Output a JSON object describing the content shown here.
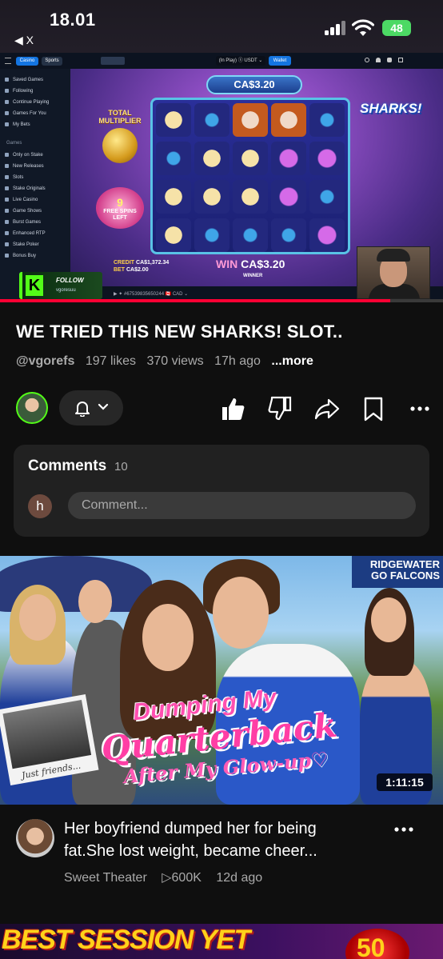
{
  "status_bar": {
    "time": "18.01",
    "back_label": "◀ X",
    "battery": "48"
  },
  "video": {
    "site": {
      "tab_casino": "Casino",
      "tab_sports": "Sports",
      "balance": "(In Play) ⓢ USDT ⌄",
      "wallet": "Wallet",
      "sidebar_items": [
        "Saved Games",
        "Following",
        "Continue Playing",
        "Games For You",
        "My Bets"
      ],
      "sidebar_section": "Games",
      "sidebar_games": [
        "Only on Stake",
        "New Releases",
        "Slots",
        "Stake Originals",
        "Live Casino",
        "Game Shows",
        "Burst Games",
        "Enhanced RTP",
        "Stake Poker",
        "Bonus Buy"
      ],
      "bottom_info": "▶ ✦ #67539835650244    🇨🇦 CAD ⌄"
    },
    "game": {
      "bet_display": "CA$3.20",
      "total_multiplier": "TOTAL MULTIPLIER",
      "free_spins_count": "9",
      "free_spins_label": "FREE SPINS LEFT",
      "logo": "SHARKS!",
      "credit_label": "CREDIT",
      "credit_value": "CA$1,372.34",
      "bet_label": "BET",
      "bet_value": "CA$2.00",
      "win_label": "WIN",
      "win_value": "CA$3.20",
      "winner": "WINNER"
    },
    "follow": {
      "label": "FOLLOW",
      "user": "vgoresuu",
      "k": "K"
    },
    "progress": 0.88
  },
  "video_info": {
    "title": "WE TRIED THIS NEW SHARKS! SLOT..",
    "channel": "@vgorefs",
    "likes": "197 likes",
    "views": "370 views",
    "age": "17h ago",
    "more": "...more"
  },
  "comments": {
    "title": "Comments",
    "count": "10",
    "avatar_letter": "h",
    "placeholder": "Comment..."
  },
  "next_video": {
    "thumb_sign": "RIDGEWATER GO FALCONS",
    "thumb_line1": "Dumping My",
    "thumb_line2": "Quarterback",
    "thumb_line3": "After My Glow-up♡",
    "polaroid_caption": "Just friends...",
    "duration": "1:11:15",
    "title_line1": "Her boyfriend dumped her for being",
    "title_line2": "fat.She lost weight, became cheer...",
    "channel": "Sweet Theater",
    "views": "▷600K",
    "age": "12d ago"
  },
  "banner": {
    "text": "BEST SESSION YET",
    "coin": "50"
  },
  "colors": {
    "background": "#0f0f0f",
    "accent_red": "#ff0033",
    "kick_green": "#53fc18"
  }
}
